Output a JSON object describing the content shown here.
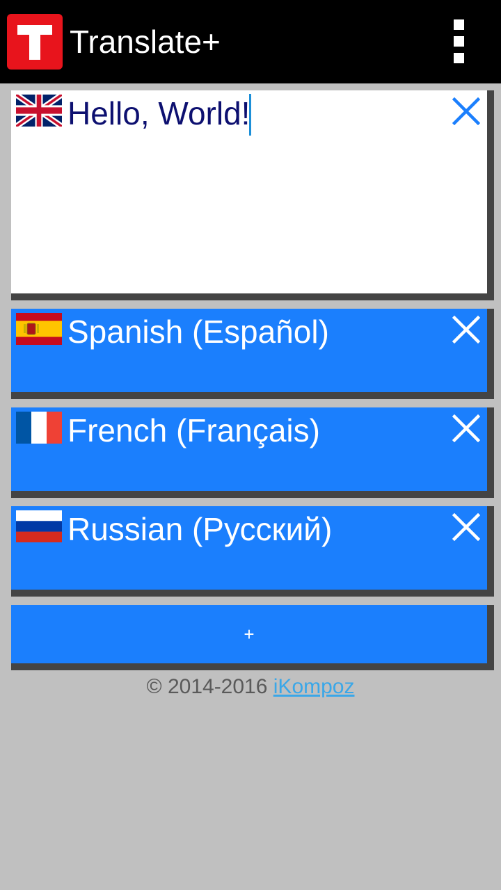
{
  "app": {
    "title": "Translate+",
    "logo_icon": "translate-plus-logo-icon",
    "menu_icon": "overflow-menu-icon",
    "accent": "#e8141c",
    "bar_color": "#000000"
  },
  "source": {
    "flag": "uk-flag-icon",
    "text": "Hello, World!",
    "close_icon": "close-icon",
    "background": "#ffffff"
  },
  "targets": [
    {
      "label": "Spanish (Español)",
      "flag": "spain-flag-icon",
      "close_icon": "close-icon"
    },
    {
      "label": "French (Français)",
      "flag": "france-flag-icon",
      "close_icon": "close-icon"
    },
    {
      "label": "Russian (Русский)",
      "flag": "russia-flag-icon",
      "close_icon": "close-icon"
    }
  ],
  "target_color": "#1b7ffd",
  "add_button": {
    "label": "+"
  },
  "footer": {
    "copyright": "© 2014-2016",
    "link_text": "iKompoz"
  }
}
